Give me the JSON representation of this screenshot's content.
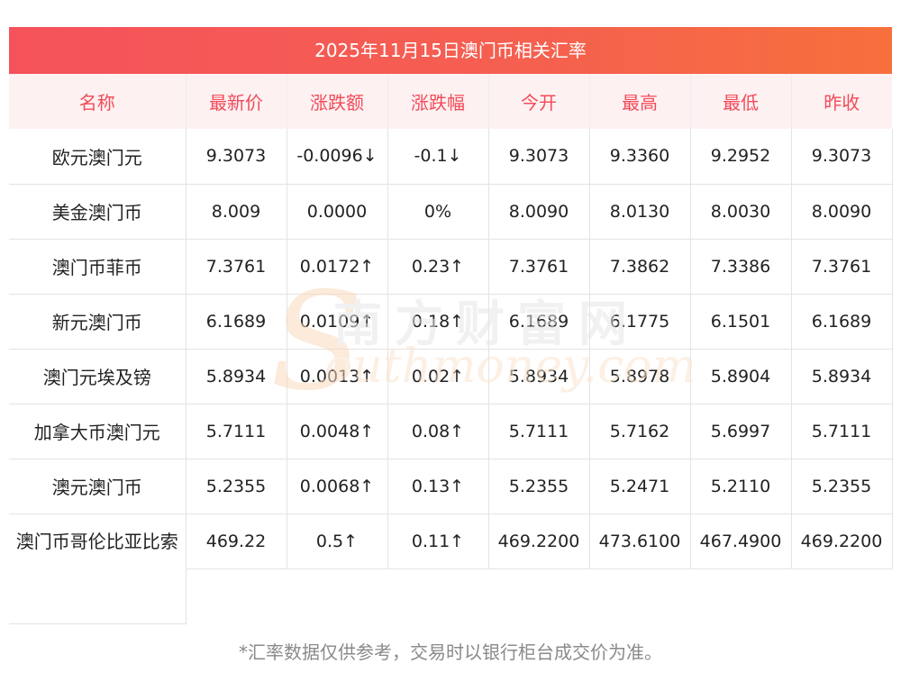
{
  "title": "2025年11月15日澳门币相关汇率",
  "columns": [
    "名称",
    "最新价",
    "涨跌额",
    "涨跌幅",
    "今开",
    "最高",
    "最低",
    "昨收"
  ],
  "rows": [
    {
      "name": "欧元澳门元",
      "latest": "9.3073",
      "change": "-0.0096↓",
      "pct": "-0.1↓",
      "open": "9.3073",
      "high": "9.3360",
      "low": "9.2952",
      "prev": "9.3073",
      "trend": "down"
    },
    {
      "name": "美金澳门币",
      "latest": "8.009",
      "change": "0.0000",
      "pct": "0%",
      "open": "8.0090",
      "high": "8.0130",
      "low": "8.0030",
      "prev": "8.0090",
      "trend": "flat"
    },
    {
      "name": "澳门币菲币",
      "latest": "7.3761",
      "change": "0.0172↑",
      "pct": "0.23↑",
      "open": "7.3761",
      "high": "7.3862",
      "low": "7.3386",
      "prev": "7.3761",
      "trend": "up"
    },
    {
      "name": "新元澳门币",
      "latest": "6.1689",
      "change": "0.0109↑",
      "pct": "0.18↑",
      "open": "6.1689",
      "high": "6.1775",
      "low": "6.1501",
      "prev": "6.1689",
      "trend": "up"
    },
    {
      "name": "澳门元埃及镑",
      "latest": "5.8934",
      "change": "0.0013↑",
      "pct": "0.02↑",
      "open": "5.8934",
      "high": "5.8978",
      "low": "5.8904",
      "prev": "5.8934",
      "trend": "up"
    },
    {
      "name": "加拿大币澳门元",
      "latest": "5.7111",
      "change": "0.0048↑",
      "pct": "0.08↑",
      "open": "5.7111",
      "high": "5.7162",
      "low": "5.6997",
      "prev": "5.7111",
      "trend": "up"
    },
    {
      "name": "澳元澳门币",
      "latest": "5.2355",
      "change": "0.0068↑",
      "pct": "0.13↑",
      "open": "5.2355",
      "high": "5.2471",
      "low": "5.2110",
      "prev": "5.2355",
      "trend": "up"
    },
    {
      "name": "澳门币哥伦比亚比索",
      "latest": "469.22",
      "change": "0.5↑",
      "pct": "0.11↑",
      "open": "469.2200",
      "high": "473.6100",
      "low": "467.4900",
      "prev": "469.2200",
      "trend": "up"
    }
  ],
  "footnote": "*汇率数据仅供参考，交易时以银行柜台成交价为准。",
  "watermark": {
    "cn": "南方财富网",
    "en": "outhmoney.com",
    "s": "S"
  },
  "colors": {
    "up": "#e8231b",
    "down": "#1a8a1a",
    "header_text": "#f24b58",
    "title_bg": "#f5525b"
  }
}
